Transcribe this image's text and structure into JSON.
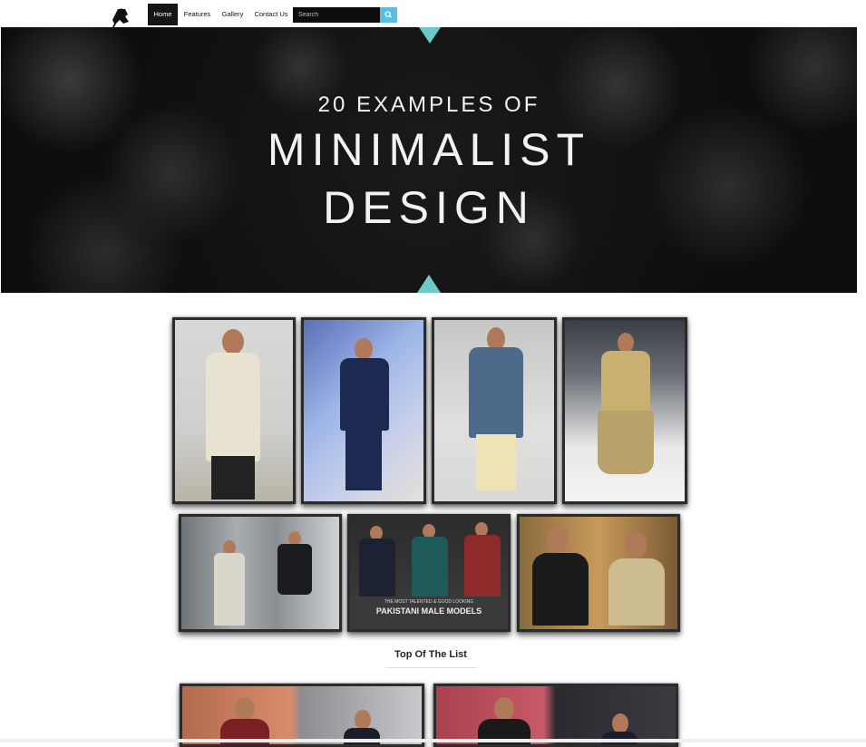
{
  "nav": {
    "items": [
      {
        "label": "Home",
        "active": true
      },
      {
        "label": "Features",
        "active": false
      },
      {
        "label": "Gallery",
        "active": false
      },
      {
        "label": "Contact Us",
        "active": false
      }
    ],
    "search_placeholder": "Search",
    "search_icon": "search-icon",
    "logo_icon": "silhouette-logo-icon"
  },
  "hero": {
    "line1": "20 EXAMPLES OF",
    "line2": "MINIMALIST",
    "line3": "DESIGN",
    "accent_color": "#6ec9c9"
  },
  "gallery_row1": [
    "photo-1",
    "photo-2",
    "photo-3",
    "photo-4"
  ],
  "gallery_row2": [
    "photo-5",
    "photo-6",
    "photo-7"
  ],
  "photo6_caption_small": "THE MOST TALENTED & GOOD LOOKING",
  "photo6_caption_main": "PAKISTANI MALE MODELS",
  "section_title": "Top Of The List",
  "colors": {
    "nav_active": "#151515",
    "search_button": "#5bc0de",
    "photo_border": "#2b2b2b"
  }
}
